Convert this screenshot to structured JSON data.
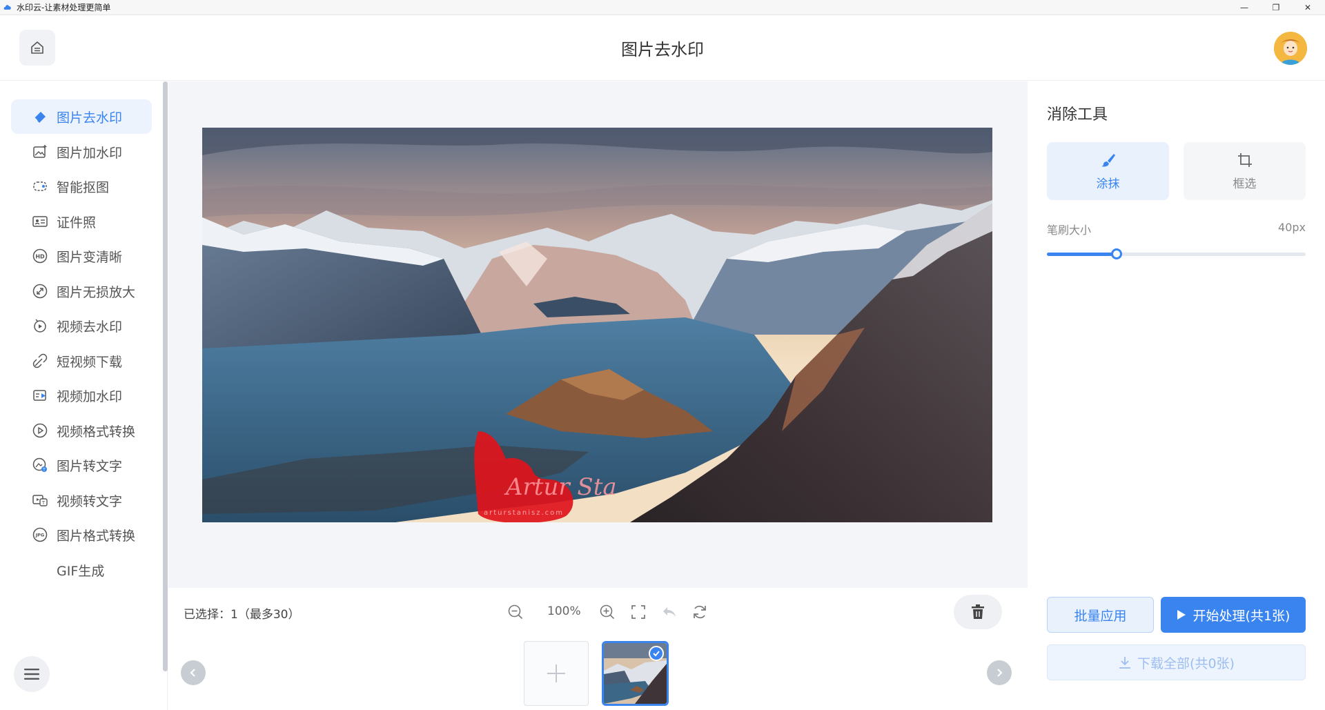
{
  "window": {
    "title": "水印云-让素材处理更简单",
    "controls": {
      "minimize": "—",
      "restore": "❐",
      "close": "✕"
    }
  },
  "header": {
    "title": "图片去水印",
    "home_icon": "home-icon",
    "avatar_icon": "user-avatar"
  },
  "sidebar": {
    "items": [
      {
        "label": "图片去水印",
        "icon": "eraser-icon",
        "active": true
      },
      {
        "label": "图片加水印",
        "icon": "image-add-icon"
      },
      {
        "label": "智能抠图",
        "icon": "cutout-icon"
      },
      {
        "label": "证件照",
        "icon": "id-card-icon"
      },
      {
        "label": "图片变清晰",
        "icon": "hd-icon"
      },
      {
        "label": "图片无损放大",
        "icon": "enlarge-icon"
      },
      {
        "label": "视频去水印",
        "icon": "video-eraser-icon"
      },
      {
        "label": "短视频下载",
        "icon": "link-download-icon"
      },
      {
        "label": "视频加水印",
        "icon": "video-add-icon"
      },
      {
        "label": "视频格式转换",
        "icon": "play-circle-icon"
      },
      {
        "label": "图片转文字",
        "icon": "image-ocr-icon"
      },
      {
        "label": "视频转文字",
        "icon": "video-ocr-icon"
      },
      {
        "label": "图片格式转换",
        "icon": "jpg-icon"
      },
      {
        "label": "GIF生成",
        "icon": "menu-icon"
      }
    ]
  },
  "canvas": {
    "image_alt": "mountain-fjord-landscape",
    "watermark_text": "Artur Sta",
    "watermark_sub": "arturstanisz.com"
  },
  "toolbar": {
    "selection": "已选择：1（最多30）",
    "zoom": "100%"
  },
  "thumbnails": {
    "count": 1,
    "selected": true
  },
  "right_panel": {
    "title": "消除工具",
    "tools": [
      {
        "label": "涂抹",
        "icon": "brush-icon",
        "active": true
      },
      {
        "label": "框选",
        "icon": "crop-icon",
        "active": false
      }
    ],
    "brush_label": "笔刷大小",
    "brush_value": "40px",
    "brush_fraction": 0.27,
    "batch_label": "批量应用",
    "start_label": "开始处理(共1张)",
    "download_label": "下载全部(共0张)"
  },
  "colors": {
    "accent": "#3a84f0",
    "accent_light": "#e9f1fd",
    "watermark_red": "#e0141b"
  }
}
